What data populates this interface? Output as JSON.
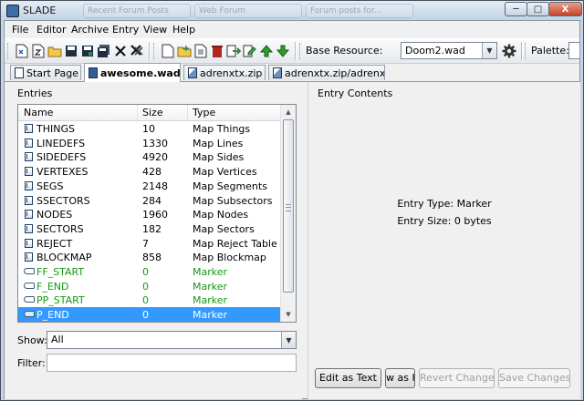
{
  "window": {
    "title": "SLADE",
    "bg_tabs": [
      "Recent Forum Posts",
      "Web Forum",
      "Forum posts for..."
    ]
  },
  "titlebar_buttons": {
    "minimize": "─",
    "maximize": "□",
    "close": "X"
  },
  "menu": [
    "File",
    "Editor",
    "Archive",
    "Entry",
    "View",
    "Help"
  ],
  "toolbar": {
    "base_resource_label": "Base Resource:",
    "base_resource_value": "Doom2.wad",
    "palette_label": "Palette:"
  },
  "tabs": [
    {
      "label": "Start Page",
      "icon": "page-icon"
    },
    {
      "label": "awesome.wad",
      "icon": "wad-icon"
    },
    {
      "label": "adrenxtx.zip",
      "icon": "zip-icon"
    },
    {
      "label": "adrenxtx.zip/adrenxtx",
      "icon": "zip-icon"
    }
  ],
  "entries_panel": {
    "title": "Entries",
    "columns": [
      "Name",
      "Size",
      "Type"
    ],
    "rows": [
      {
        "name": "THINGS",
        "size": "10",
        "type": "Map Things",
        "kind": "lump"
      },
      {
        "name": "LINEDEFS",
        "size": "1330",
        "type": "Map Lines",
        "kind": "lump"
      },
      {
        "name": "SIDEDEFS",
        "size": "4920",
        "type": "Map Sides",
        "kind": "lump"
      },
      {
        "name": "VERTEXES",
        "size": "428",
        "type": "Map Vertices",
        "kind": "lump"
      },
      {
        "name": "SEGS",
        "size": "2148",
        "type": "Map Segments",
        "kind": "lump"
      },
      {
        "name": "SSECTORS",
        "size": "284",
        "type": "Map Subsectors",
        "kind": "lump"
      },
      {
        "name": "NODES",
        "size": "1960",
        "type": "Map Nodes",
        "kind": "lump"
      },
      {
        "name": "SECTORS",
        "size": "182",
        "type": "Map Sectors",
        "kind": "lump"
      },
      {
        "name": "REJECT",
        "size": "7",
        "type": "Map Reject Table",
        "kind": "lump"
      },
      {
        "name": "BLOCKMAP",
        "size": "858",
        "type": "Map Blockmap",
        "kind": "lump"
      },
      {
        "name": "FF_START",
        "size": "0",
        "type": "Marker",
        "kind": "marker"
      },
      {
        "name": "F_END",
        "size": "0",
        "type": "Marker",
        "kind": "marker"
      },
      {
        "name": "PP_START",
        "size": "0",
        "type": "Marker",
        "kind": "marker"
      },
      {
        "name": "P_END",
        "size": "0",
        "type": "Marker",
        "kind": "marker",
        "selected": true
      }
    ],
    "show_label": "Show:",
    "show_value": "All",
    "filter_label": "Filter:",
    "filter_value": ""
  },
  "entry_contents": {
    "title": "Entry Contents",
    "entry_type": "Entry Type: Marker",
    "entry_size": "Entry Size: 0 bytes",
    "buttons": {
      "edit_as_text": "Edit as Text",
      "view_as_hex": "w as H",
      "revert": "Revert Changes",
      "save": "Save Changes"
    }
  },
  "colors": {
    "marker_text": "#179914",
    "selection": "#3399ff"
  }
}
